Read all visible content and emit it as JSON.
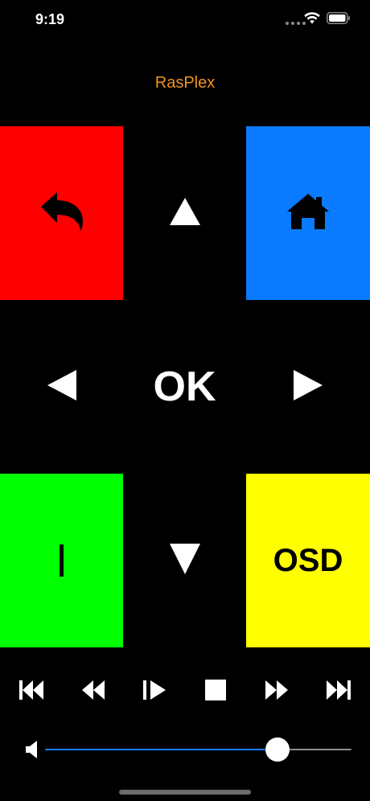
{
  "status_bar": {
    "time": "9:19",
    "icons": [
      "wifi-icon",
      "battery-icon"
    ]
  },
  "app": {
    "title": "RasPlex",
    "title_color": "#f0921e"
  },
  "tiles": {
    "back": {
      "icon": "back-arrow-icon",
      "color": "#ff0000"
    },
    "home": {
      "icon": "home-icon",
      "color": "#0a7aff"
    },
    "info": {
      "label": "|",
      "color": "#00ff00"
    },
    "osd": {
      "label": "OSD",
      "color": "#ffff00"
    }
  },
  "dpad": {
    "up_icon": "triangle-up-icon",
    "down_icon": "triangle-down-icon",
    "left_icon": "triangle-left-icon",
    "right_icon": "triangle-right-icon",
    "ok_label": "OK"
  },
  "transport": [
    {
      "name": "skip-back",
      "icon": "skip-back-icon"
    },
    {
      "name": "rewind",
      "icon": "rewind-icon"
    },
    {
      "name": "play-pause",
      "icon": "play-pause-icon"
    },
    {
      "name": "stop",
      "icon": "stop-icon"
    },
    {
      "name": "fast-forward",
      "icon": "fast-forward-icon"
    },
    {
      "name": "skip-forward",
      "icon": "skip-forward-icon"
    }
  ],
  "volume": {
    "icon": "speaker-icon",
    "level": 0.758,
    "fill_color": "#1a7cf5"
  }
}
